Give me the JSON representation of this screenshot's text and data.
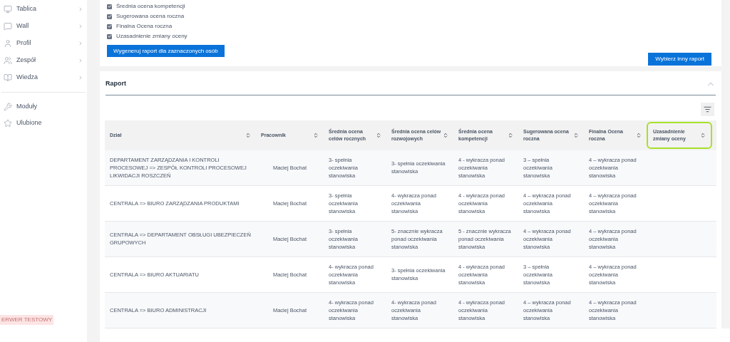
{
  "sidebar": {
    "items": [
      {
        "label": "Tablica"
      },
      {
        "label": "Wall"
      },
      {
        "label": "Profil"
      },
      {
        "label": "Zespół"
      },
      {
        "label": "Wiedza"
      }
    ],
    "secondary_items": [
      {
        "label": "Moduły"
      },
      {
        "label": "Ulubione"
      }
    ],
    "server_badge": "ERWER TESTOWY"
  },
  "options": {
    "checkboxes": [
      {
        "label": "Średnia ocena kompetencji",
        "checked": true
      },
      {
        "label": "Sugerowana ocena roczna",
        "checked": true
      },
      {
        "label": "Finalna Ocena roczna",
        "checked": true
      },
      {
        "label": "Uzasadnienie zmiany oceny",
        "checked": true
      }
    ],
    "generate_button": "Wygeneruj raport dla zaznaczonych osób",
    "other_report_button": "Wybierz inny raport"
  },
  "report": {
    "title": "Raport",
    "columns": [
      {
        "label": "Dział",
        "highlighted": false
      },
      {
        "label": "Pracownik",
        "highlighted": false
      },
      {
        "label": "Średnia ocena celów rocznych",
        "highlighted": false
      },
      {
        "label": "Średnia ocena celów rozwojowych",
        "highlighted": false
      },
      {
        "label": "Średnia ocena kompetencji",
        "highlighted": false
      },
      {
        "label": "Sugerowana ocena roczna",
        "highlighted": false
      },
      {
        "label": "Finalna Ocena roczna",
        "highlighted": false
      },
      {
        "label": "Uzasadnienie zmiany oceny",
        "highlighted": true
      }
    ],
    "rows": [
      [
        "DEPARTAMENT ZARZĄDZANIA I KONTROLI PROCESOWEJ => ZESPÓŁ KONTROLI PROCESOWEJ LIKWIDACJI ROSZCZEŃ",
        "Maciej Bochat",
        "3- spełnia oczekiwania stanowiska",
        "3- spełnia oczekiwania stanowiska",
        "4 - wykracza ponad oczekiwania stanowiska",
        "3 – spełnia oczekiwania stanowiska",
        "4 – wykracza ponad oczekiwania stanowiska"
      ],
      [
        "CENTRALA => BIURO ZARZĄDZANIA PRODUKTAMI",
        "Maciej Bochat",
        "3- spełnia oczekiwania stanowiska",
        "4- wykracza ponad oczekiwania stanowiska",
        "4 - wykracza ponad oczekiwania stanowiska",
        "4 – wykracza ponad oczekiwania stanowiska",
        "4 – wykracza ponad oczekiwania stanowiska"
      ],
      [
        "CENTRALA => DEPARTAMENT OBSŁUGI UBEZPIECZEŃ GRUPOWYCH",
        "Maciej Bochat",
        "3- spełnia oczekiwania stanowiska",
        "5- znacznie wykracza ponad oczekiwania stanowiska",
        "5 - znacznie wykracza ponad oczekiwania stanowiska",
        "4 – wykracza ponad oczekiwania stanowiska",
        "4 – wykracza ponad oczekiwania stanowiska"
      ],
      [
        "CENTRALA => BIURO AKTUARIATU",
        "Maciej Bochat",
        "4- wykracza ponad oczekiwania stanowiska",
        "3- spełnia oczekiwania stanowiska",
        "4 - wykracza ponad oczekiwania stanowiska",
        "3 – spełnia oczekiwania stanowiska",
        "4 – wykracza ponad oczekiwania stanowiska"
      ],
      [
        "CENTRALA => BIURO ADMINISTRACJI",
        "Maciej Bochat",
        "4- wykracza ponad oczekiwania stanowiska",
        "4- wykracza ponad oczekiwania stanowiska",
        "4 - wykracza ponad oczekiwania stanowiska",
        "4 – wykracza ponad oczekiwania stanowiska",
        "4 – wykracza ponad oczekiwania stanowiska"
      ]
    ]
  }
}
